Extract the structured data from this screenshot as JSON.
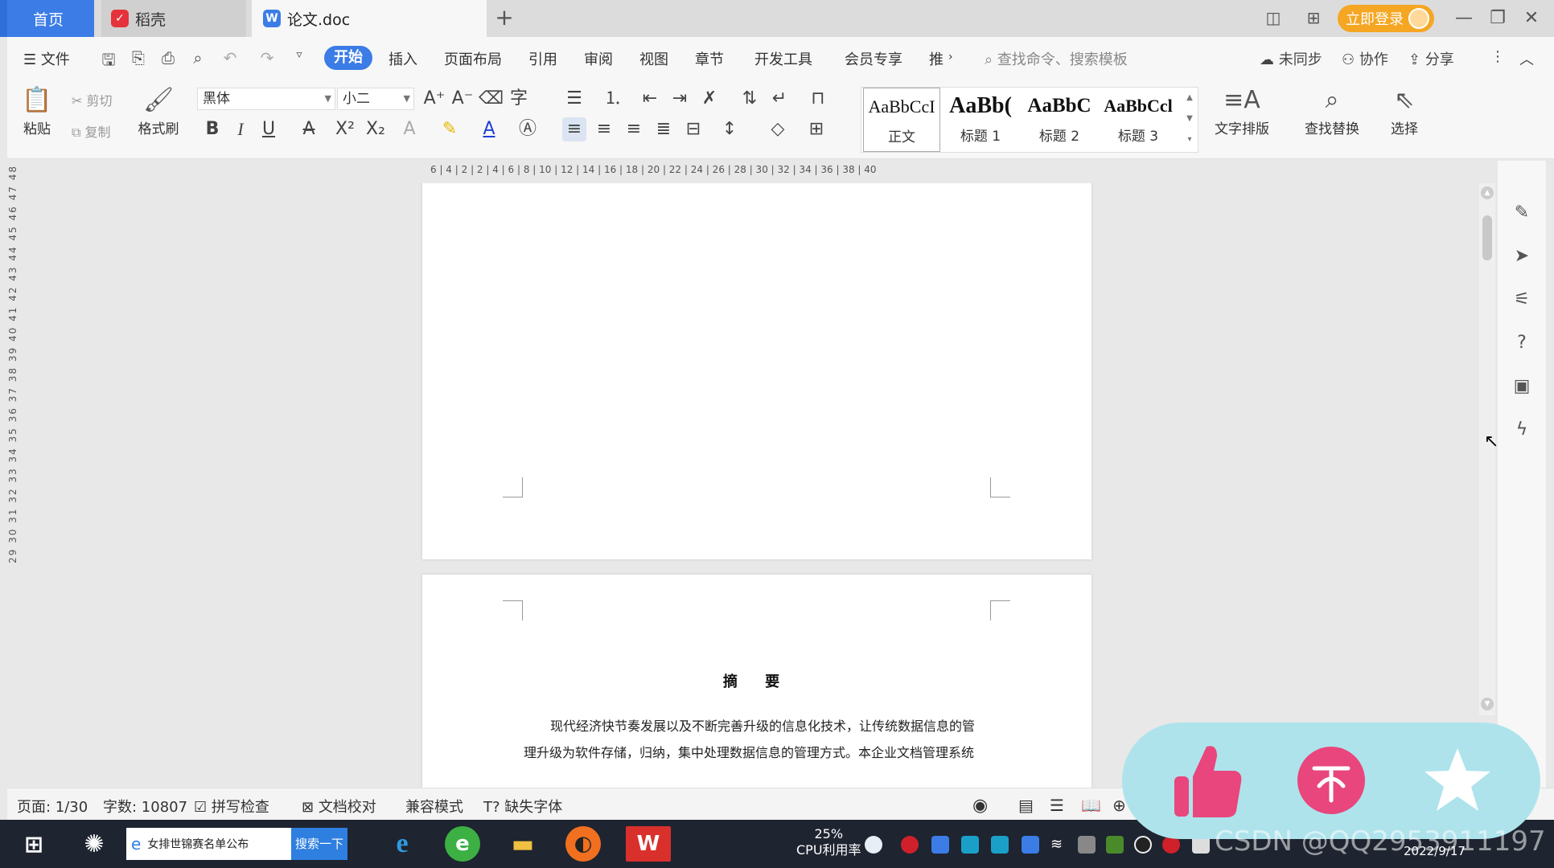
{
  "titlebar": {
    "tabs": {
      "home": "首页",
      "daoke": "稻壳",
      "doc": "论文.doc"
    },
    "login": "立即登录"
  },
  "menubar": {
    "file": "文件",
    "items": [
      "开始",
      "插入",
      "页面布局",
      "引用",
      "审阅",
      "视图",
      "章节",
      "开发工具",
      "会员专享",
      "推"
    ],
    "search_placeholder": "查找命令、搜索模板",
    "sync": "未同步",
    "collab": "协作",
    "share": "分享"
  },
  "ribbon": {
    "paste": "粘贴",
    "cut": "剪切",
    "copy": "复制",
    "format_painter": "格式刷",
    "font_name": "黑体",
    "font_size": "小二",
    "styles": [
      {
        "sample": "AaBbCcI",
        "name": "正文"
      },
      {
        "sample": "AaBb(",
        "name": "标题 1"
      },
      {
        "sample": "AaBbC",
        "name": "标题 2"
      },
      {
        "sample": "AaBbCcl",
        "name": "标题 3"
      }
    ],
    "text_layout": "文字排版",
    "find_replace": "查找替换",
    "select": "选择"
  },
  "ruler": {
    "h_ticks": "6 | 4 | 2 | 2 | 4 | 6 | 8 | 10 | 12 | 14 | 16 | 18 | 20 | 22 | 24 | 26 | 28 | 30 | 32 | 34 | 36 | 38 | 40",
    "v_ticks": "29 30 31 32 33 34 35 36 37 38 39 40 41 42 43 44 45 46 47 48"
  },
  "document": {
    "abstract_title": "摘 要",
    "abstract_lines": [
      "现代经济快节奏发展以及不断完善升级的信息化技术，让传统数据信息的管",
      "理升级为软件存储，归纳，集中处理数据信息的管理方式。本企业文档管理系统"
    ]
  },
  "statusbar": {
    "page": "页面: 1/30",
    "wordcount": "字数: 10807",
    "spellcheck": "拼写检查",
    "proofread": "文档校对",
    "compat": "兼容模式",
    "missing_font": "缺失字体"
  },
  "taskbar": {
    "search_query": "女排世锦赛名单公布",
    "search_button": "搜索一下",
    "cpu_percent": "25%",
    "cpu_label": "CPU利用率",
    "clock": "2022/9/17"
  },
  "watermark": "CSDN @QQ2953911197",
  "colors": {
    "accent": "#3b7ce6",
    "login": "#f5a623",
    "overlay": "#aee3ec",
    "overlay_icon": "#e8467c"
  }
}
